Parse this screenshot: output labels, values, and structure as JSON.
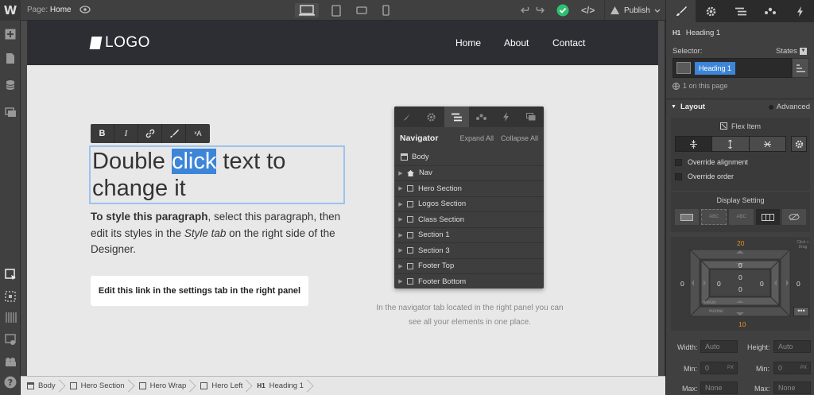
{
  "app": {
    "logo": "W"
  },
  "topbar": {
    "page_prefix": "Page:",
    "page_name": "Home",
    "publish_label": "Publish",
    "code_label": "</>"
  },
  "canvas": {
    "site_logo": "LOGO",
    "nav": [
      "Home",
      "About",
      "Contact"
    ],
    "rte_buttons": [
      "B",
      "I",
      "🔗",
      "✎",
      "ˣA"
    ],
    "heading_before": "Double ",
    "heading_highlight": "click",
    "heading_after": " text to change it",
    "para_bold": "To style this paragraph",
    "para_text1": ", select this paragraph, then edit its styles in the ",
    "para_italic": "Style tab",
    "para_text2": " on the right side of the Designer.",
    "link_label": "Edit this link in the settings tab in the right panel",
    "caption_line1": "In the navigator tab located in the right panel you can",
    "caption_line2": "see all your elements in one place."
  },
  "navigator": {
    "title": "Navigator",
    "expand_all": "Expand All",
    "collapse_all": "Collapse All",
    "body": "Body",
    "rows": [
      "Nav",
      "Hero Section",
      "Logos Section",
      "Class Section",
      "Section 1",
      "Section 3",
      "Footer Top",
      "Footer Bottom"
    ]
  },
  "breadcrumb": [
    {
      "label": "Body",
      "type": "body"
    },
    {
      "label": "Hero Section",
      "type": "box"
    },
    {
      "label": "Hero Wrap",
      "type": "box"
    },
    {
      "label": "Hero Left",
      "type": "box"
    },
    {
      "label": "Heading 1",
      "type": "h1"
    }
  ],
  "panel": {
    "element_tag": "H1",
    "element_name": "Heading 1",
    "selector_label": "Selector:",
    "states_label": "States",
    "selector_chip": "Heading 1",
    "on_page": "1 on this page",
    "layout_label": "Layout",
    "advanced_label": "Advanced",
    "flex_item_label": "Flex Item",
    "override_alignment": "Override alignment",
    "override_order": "Override order",
    "display_setting": "Display Setting",
    "display_options": [
      "",
      "ABC",
      "ABC",
      "",
      ""
    ],
    "margin_top": "20",
    "margin_bottom": "10",
    "margin_left": "0",
    "margin_right": "0",
    "padding_top": "0",
    "padding_bottom": "0",
    "padding_left": "0",
    "padding_right": "0",
    "margin_tag": "MARGIN",
    "padding_tag": "PADDING",
    "click_hint": "Click + Drag",
    "width_label": "Width:",
    "width_value": "Auto",
    "height_label": "Height:",
    "height_value": "Auto",
    "min_label": "Min:",
    "min_w": "0",
    "min_h": "0",
    "px_unit": "PX",
    "max_label": "Max:",
    "max_w": "None",
    "max_h": "None"
  },
  "colors": {
    "accent": "#3d85d8",
    "sync_ok": "#2fbf71",
    "orange": "#e8902c"
  }
}
